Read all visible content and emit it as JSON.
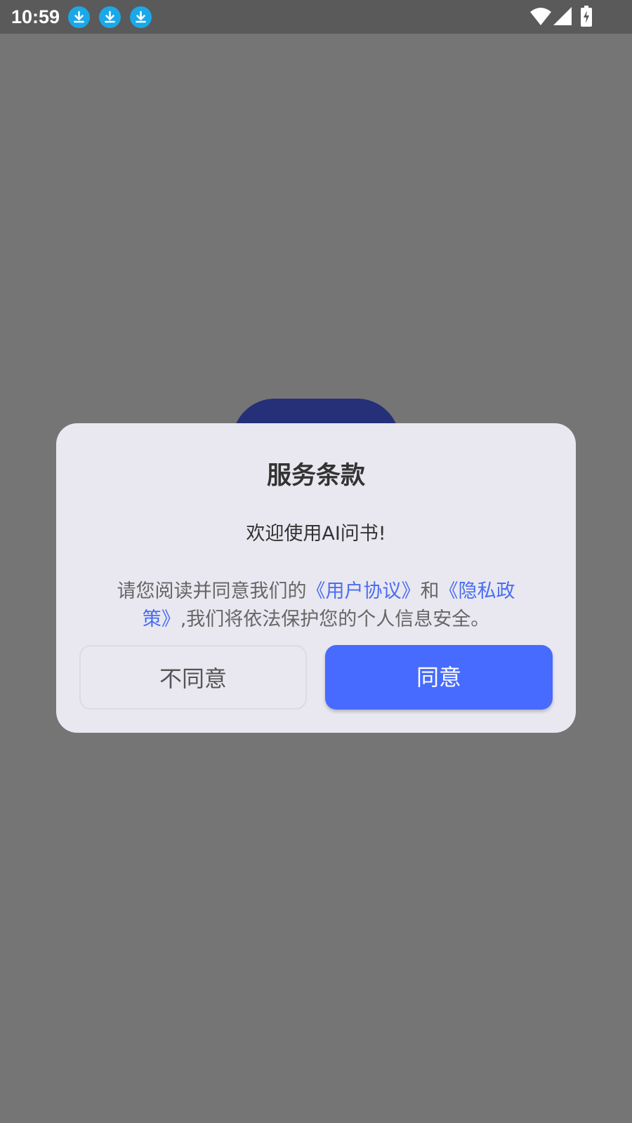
{
  "status_bar": {
    "time": "10:59",
    "notification_icons": [
      "download-icon",
      "download-icon",
      "download-icon"
    ],
    "system_icons": [
      "wifi-icon",
      "signal-icon",
      "battery-charging-icon"
    ]
  },
  "dialog": {
    "title": "服务条款",
    "welcome": "欢迎使用AI问书!",
    "body": {
      "prefix": "请您阅读并同意我们的",
      "user_agreement_link": "《用户协议》",
      "conjunction": "和",
      "privacy_policy_link": "《隐私政策》",
      "suffix": ",我们将依法保护您的个人信息安全。"
    },
    "buttons": {
      "disagree": "不同意",
      "agree": "同意"
    }
  },
  "colors": {
    "scrim": "#757575",
    "status_bar": "#5a5a5a",
    "dialog_bg": "#e9e8f0",
    "accent": "#476bff",
    "link": "#4a6ef0",
    "download_icon": "#1ba8e8",
    "background_blob": "#253078"
  }
}
